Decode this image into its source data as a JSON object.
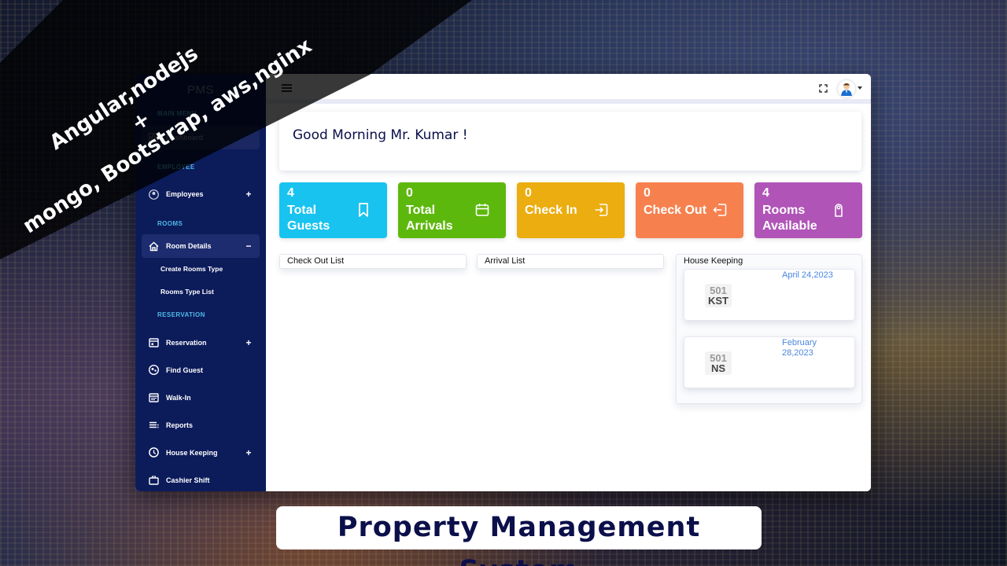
{
  "overlay": {
    "tech_line1": "Angular,nodejs",
    "tech_plus": "+",
    "tech_line2": "mongo, Bootstrap, aws,nginx"
  },
  "banner": {
    "title": "Property Management System"
  },
  "app": {
    "brand": "PMS",
    "sidebar": {
      "sections": {
        "main_menu": "MAIN MENU",
        "employee": "EMPLOYEE",
        "rooms": "ROOMS",
        "reservation": "RESERVATION"
      },
      "items": {
        "dashboard": {
          "label": "Dashboard",
          "icon": "grid-icon"
        },
        "employees": {
          "label": "Employees",
          "icon": "user-circle-icon",
          "toggle": "+"
        },
        "room_details": {
          "label": "Room Details",
          "icon": "home-icon",
          "toggle": "−",
          "expanded": true,
          "sub_items": [
            "Create Rooms Type",
            "Rooms Type List"
          ]
        },
        "reservation": {
          "label": "Reservation",
          "icon": "calendar-icon",
          "toggle": "+"
        },
        "find_guest": {
          "label": "Find Guest",
          "icon": "find-user-icon"
        },
        "walk_in": {
          "label": "Walk-In",
          "icon": "calendar-list-icon"
        },
        "reports": {
          "label": "Reports",
          "icon": "list-icon"
        },
        "house_keeping": {
          "label": "House Keeping",
          "icon": "clock-icon",
          "toggle": "+"
        },
        "cashier_shift": {
          "label": "Cashier Shift",
          "icon": "briefcase-icon"
        }
      }
    },
    "topbar": {
      "menu_icon": "hamburger-icon",
      "fullscreen_icon": "fullscreen-icon",
      "avatar_icon": "user-avatar-icon"
    },
    "greeting": "Good Morning Mr. Kumar !",
    "stats": [
      {
        "value": "4",
        "label": "Total Guests",
        "icon": "bookmark-icon",
        "color": "#19c3ef"
      },
      {
        "value": "0",
        "label": "Total Arrivals",
        "icon": "calendar-icon",
        "color": "#5db80d"
      },
      {
        "value": "0",
        "label": "Check In",
        "icon": "login-icon",
        "color": "#ebad0f"
      },
      {
        "value": "0",
        "label": "Check Out",
        "icon": "logout-icon",
        "color": "#f6814f"
      },
      {
        "value": "4",
        "label": "Rooms Available",
        "icon": "door-hanger-icon",
        "color": "#b054b8"
      }
    ],
    "lists": {
      "check_out": "Check Out List",
      "arrival": "Arrival List",
      "house_keeping": {
        "title": "House Keeping",
        "items": [
          {
            "room": "501",
            "code": "KST",
            "date": "April 24,2023"
          },
          {
            "room": "501",
            "code": "NS",
            "date": "February 28,2023"
          }
        ]
      }
    }
  }
}
